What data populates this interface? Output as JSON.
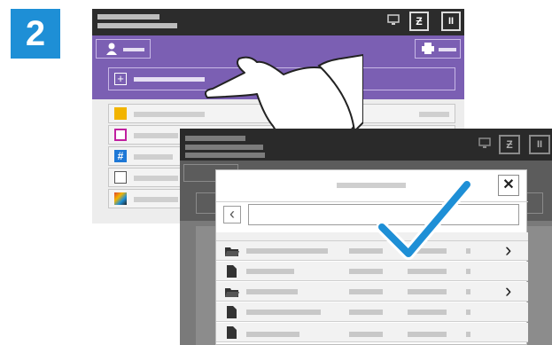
{
  "step_number": "2",
  "colors": {
    "step_blue": "#1e8fd6",
    "header_dark": "#2c2c2c",
    "accent_purple": "#7b5fb3",
    "dialog_white": "#ffffff",
    "overlay": "#7a7a7a",
    "check_blue": "#1e8fd6"
  },
  "icons": {
    "user": "user-icon",
    "printer": "printer-icon",
    "plus": "plus-icon",
    "dropbox": "dropbox-doc-icon",
    "box": "box-doc-icon",
    "hash": "hash-icon",
    "list": "list-icon",
    "color": "color-icon",
    "close": "close-icon",
    "back": "chevron-left-icon",
    "folder": "folder-icon",
    "file": "file-icon",
    "forward": "chevron-right-icon",
    "check": "checkmark-icon",
    "hand": "pointing-hand-icon",
    "monitor": "monitor-icon",
    "swap": "swap-icon",
    "pause": "pause-icon"
  },
  "close_glyph": "✕",
  "back_glyph": "‹",
  "forward_glyph": "›",
  "pause_glyph": "II"
}
